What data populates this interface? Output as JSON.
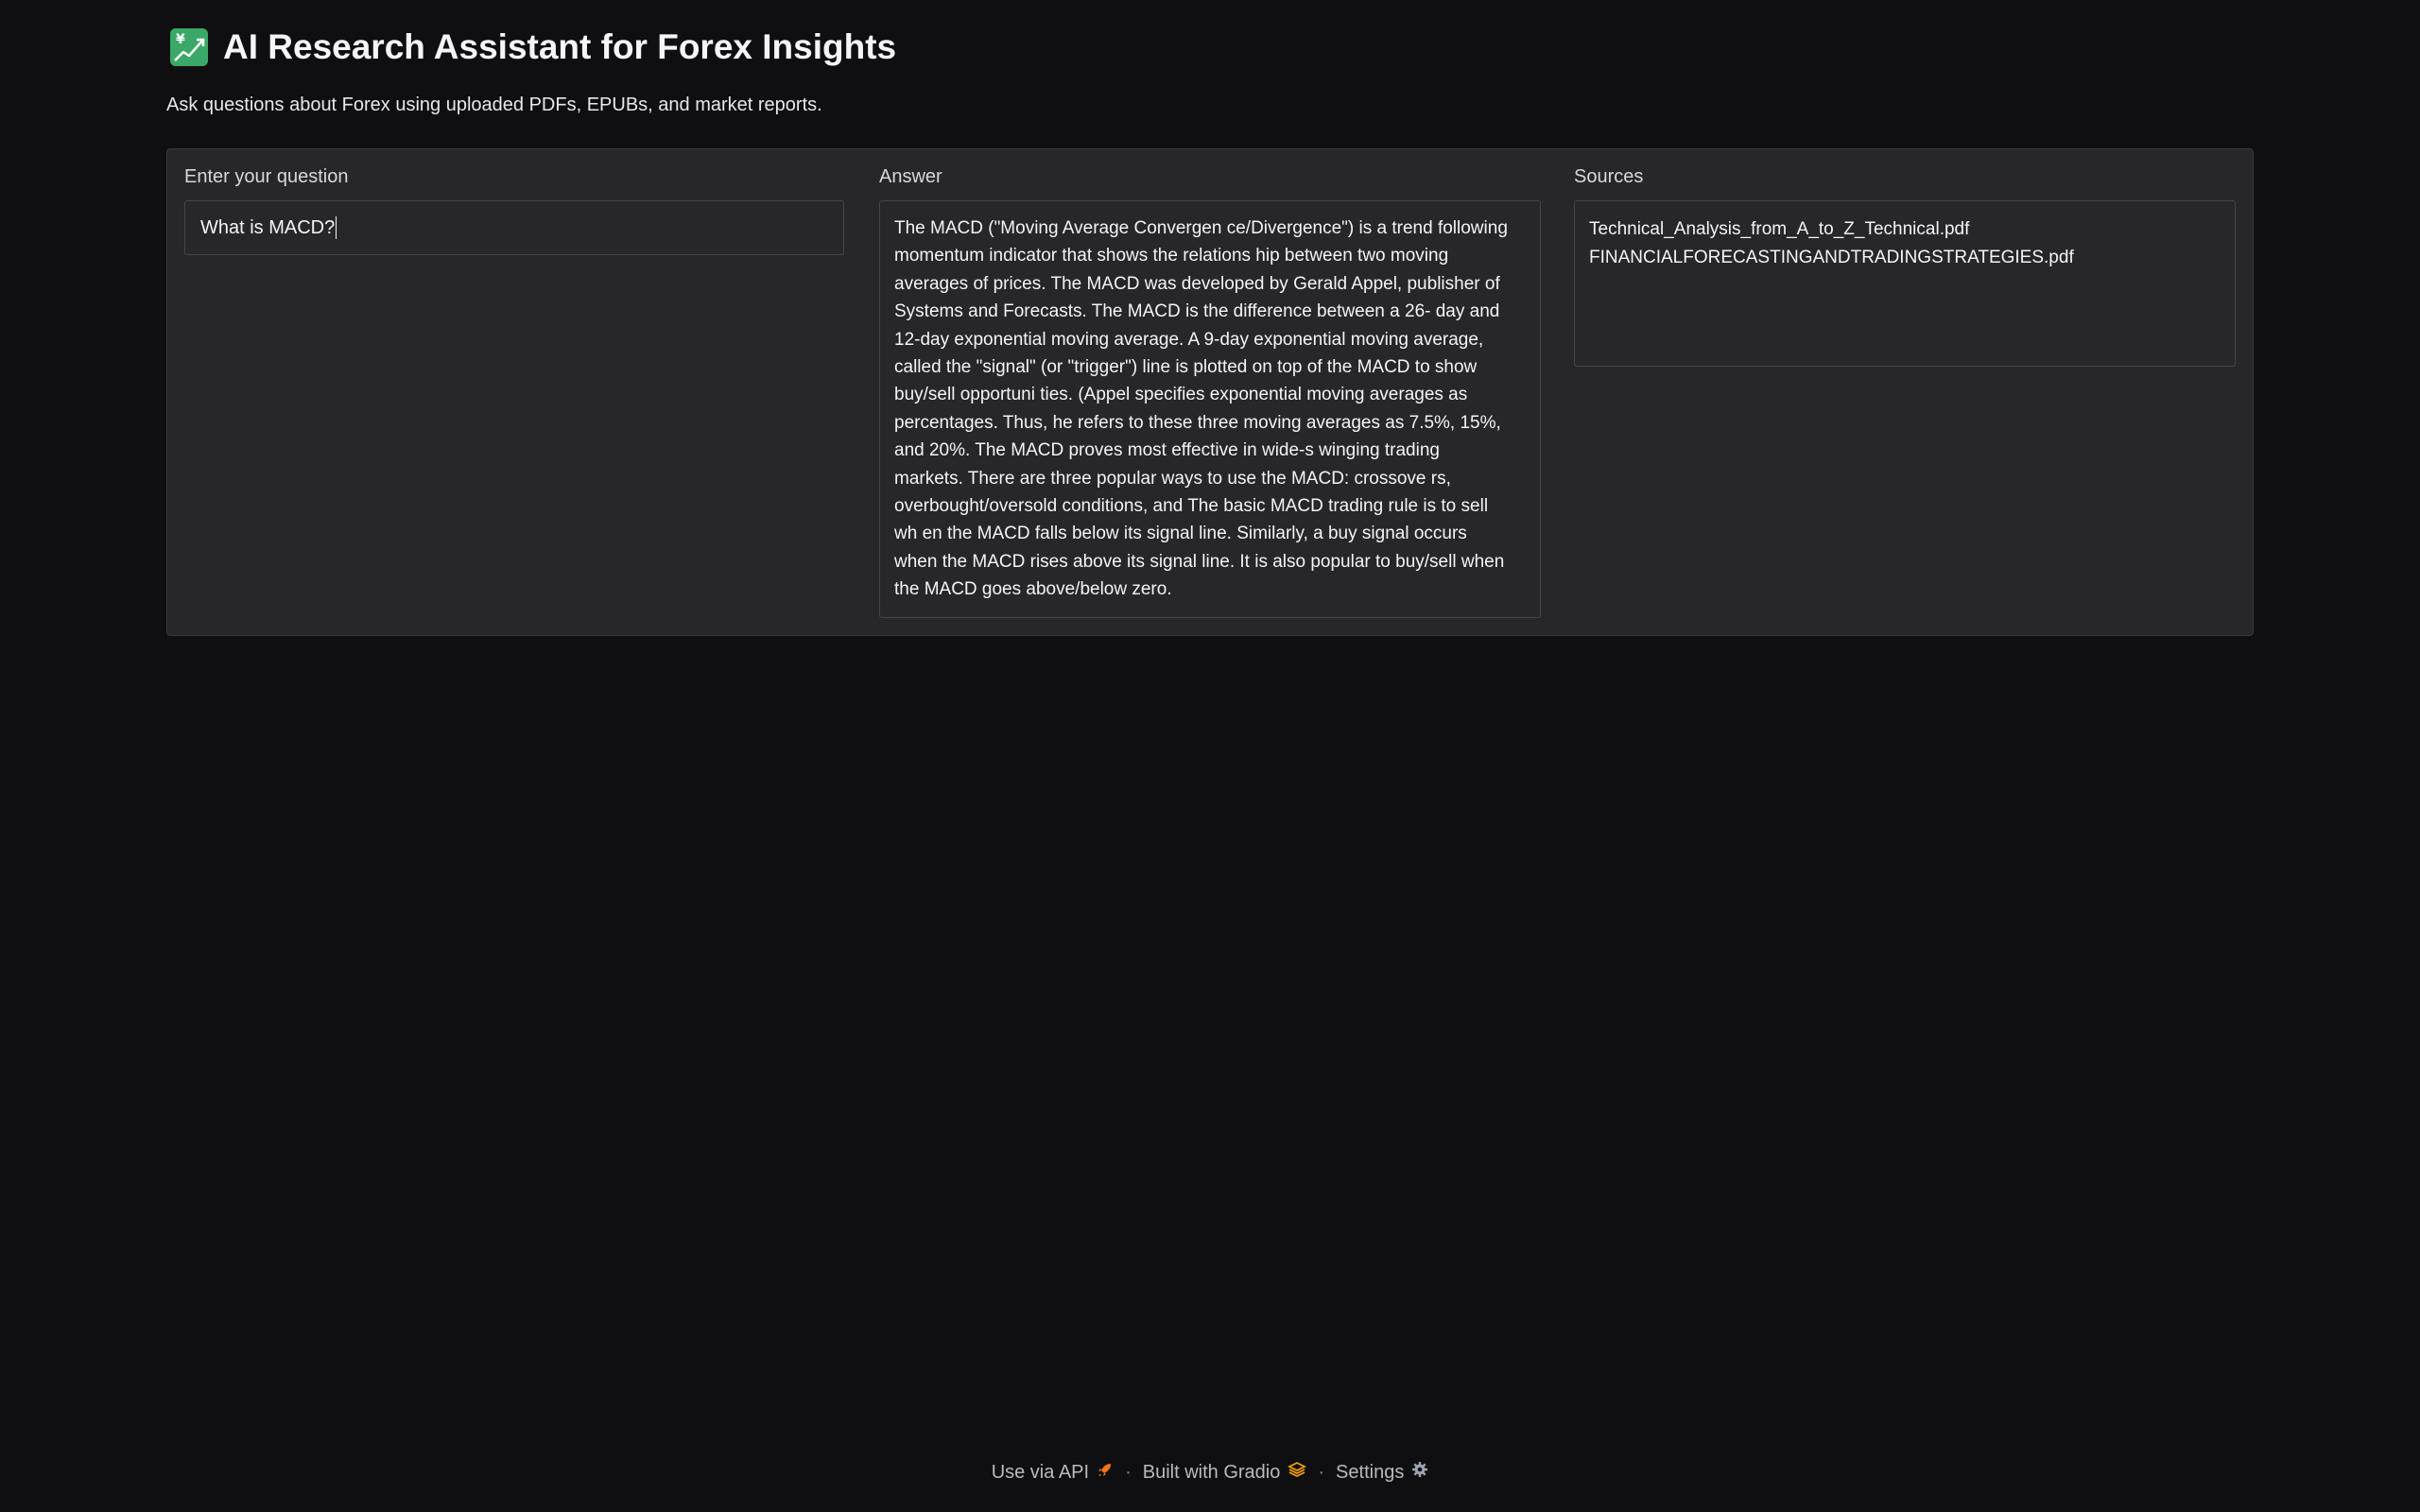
{
  "header": {
    "title": "AI Research Assistant for Forex Insights",
    "title_icon": "chart-increasing-yen-icon",
    "subtitle": "Ask questions about Forex using uploaded PDFs, EPUBs, and market reports."
  },
  "question": {
    "label": "Enter your question",
    "value": "What is MACD?"
  },
  "answer": {
    "label": "Answer",
    "lines": [
      "The MACD (\"Moving Average Convergen ce/Divergence\") is a trend following",
      "momentum indicator that shows the relations hip between two moving",
      "averages of prices. The MACD was developed by Gerald Appel, publisher of",
      "Systems and Forecasts. The MACD is the difference between a 26- day and",
      "12-day exponential moving average. A 9-day exponential moving average,",
      "called the \"signal\" (or \"trigger\") line is plotted on top of the MACD to show",
      "buy/sell opportuni ties. (Appel specifies exponential moving averages as",
      "percentages. Thus, he refers to these three moving averages as 7.5%, 15%,",
      "and 20%. The MACD proves most effective in wide-s winging trading",
      "markets. There are three popular ways to use the MACD: crossove rs,",
      "overbought/oversold conditions, and The basic MACD trading rule is to sell",
      "wh en the MACD falls below its signal line. Similarly, a buy signal occurs",
      "when the MACD rises above its signal line. It is also popular to buy/sell when",
      "the MACD goes above/below zero."
    ]
  },
  "sources": {
    "label": "Sources",
    "items": [
      "Technical_Analysis_from_A_to_Z_Technical.pdf",
      "FINANCIALFORECASTINGANDTRADINGSTRATEGIES.pdf"
    ]
  },
  "footer": {
    "api_label": "Use via API",
    "api_icon": "rocket-icon",
    "separator": "·",
    "built_label": "Built with Gradio",
    "built_icon": "gradio-logo-icon",
    "settings_label": "Settings",
    "settings_icon": "gear-icon"
  },
  "colors": {
    "background": "#0f0f11",
    "panel": "#27272a",
    "accent_orange": "#f59e0b"
  }
}
